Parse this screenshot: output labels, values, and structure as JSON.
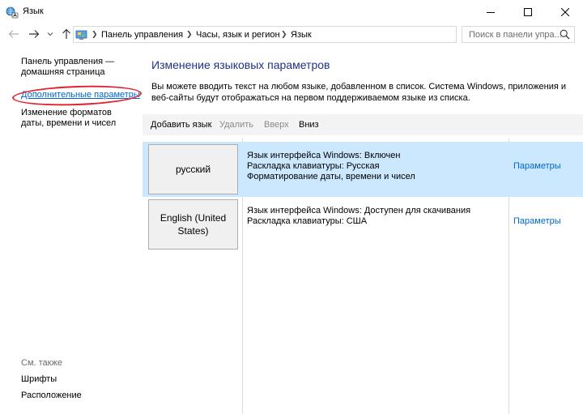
{
  "window": {
    "title": "Язык"
  },
  "address": {
    "crumbs": [
      "Панель управления",
      "Часы, язык и регион",
      "Язык"
    ]
  },
  "search": {
    "placeholder": "Поиск в панели упра..."
  },
  "left_pane": {
    "home_link": "Панель управления — домашняя страница",
    "advanced_link": "Дополнительные параметры",
    "formats_link": "Изменение форматов даты, времени и чисел",
    "see_also": "См. также",
    "fonts_link": "Шрифты",
    "location_link": "Расположение"
  },
  "main": {
    "title": "Изменение языковых параметров",
    "description": "Вы можете вводить текст на любом языке, добавленном в список. Система Windows, приложения и веб-сайты будут отображаться на первом поддерживаемом языке из списка."
  },
  "toolbar": {
    "add": "Добавить язык",
    "remove": "Удалить",
    "up": "Вверх",
    "down": "Вниз"
  },
  "languages": [
    {
      "name": "русский",
      "lines": [
        "Язык интерфейса Windows: Включен",
        "Раскладка клавиатуры: Русская",
        "Форматирование даты, времени и чисел"
      ],
      "options": "Параметры",
      "selected": true
    },
    {
      "name": "English (United States)",
      "lines": [
        "Язык интерфейса Windows: Доступен для скачивания",
        "Раскладка клавиатуры: США"
      ],
      "options": "Параметры",
      "selected": false
    }
  ],
  "colors": {
    "title_blue": "#1e3287",
    "link_blue": "#0066cc",
    "selected_row": "#cce8ff",
    "annotation_red": "#e0232f"
  }
}
